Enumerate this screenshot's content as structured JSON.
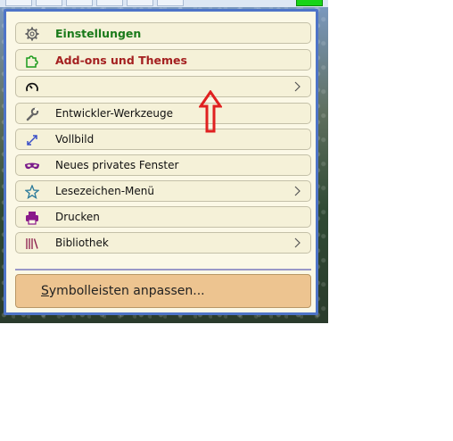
{
  "menu": {
    "items": [
      {
        "label": "Einstellungen",
        "icon": "gear-icon",
        "color": "#1a7a1a"
      },
      {
        "label": "Add-ons und Themes",
        "icon": "puzzle-icon",
        "color": "#a42020"
      },
      {
        "label": "",
        "icon": "speedometer-icon"
      },
      {
        "label": "Entwickler-Werkzeuge",
        "icon": "wrench-icon"
      },
      {
        "label": "Vollbild",
        "icon": "fullscreen-arrow-icon"
      },
      {
        "label": "Neues privates Fenster",
        "icon": "private-mask-icon"
      },
      {
        "label": "Lesezeichen-Menü",
        "icon": "bookmark-star-icon"
      },
      {
        "label": "Drucken",
        "icon": "printer-icon"
      },
      {
        "label": "Bibliothek",
        "icon": "library-icon"
      }
    ],
    "customize": {
      "label": "Symbolleisten anpassen...",
      "accesskey": "S",
      "label_rest": "ymbolleisten anpassen..."
    }
  },
  "colors": {
    "menu_border": "#4e74c8",
    "menu_bg": "#fbf8e6",
    "item_bg": "#f5f1d8",
    "customize_bg": "#edc490",
    "annotation_arrow": "#e02020"
  }
}
